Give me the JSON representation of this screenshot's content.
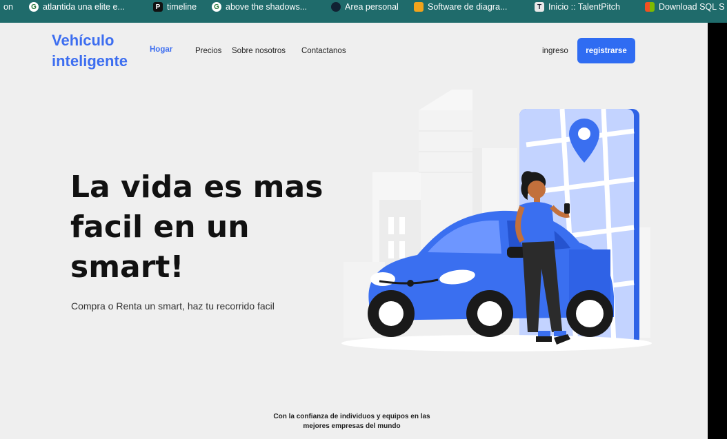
{
  "bookmarks": [
    {
      "label": "on",
      "icon": "none"
    },
    {
      "label": "atlantida una elite e...",
      "icon": "google-icon"
    },
    {
      "label": "timeline",
      "icon": "p-icon"
    },
    {
      "label": "above the shadows...",
      "icon": "google-icon"
    },
    {
      "label": "Area personal",
      "icon": "avatar-icon"
    },
    {
      "label": "Software de diagra...",
      "icon": "diagram-app-icon"
    },
    {
      "label": "Inicio :: TalentPitch",
      "icon": "talentpitch-icon"
    },
    {
      "label": "Download SQL S",
      "icon": "microsoft-icon"
    }
  ],
  "nav": {
    "brand": "Vehículo inteligente",
    "links": [
      "Hogar",
      "Precios",
      "Sobre nosotros",
      "Contactanos"
    ],
    "login": "ingreso",
    "signup": "registrarse"
  },
  "hero": {
    "title": "La vida es mas facil en un smart!",
    "subtitle": "Compra o Renta un smart, haz tu recorrido facil"
  },
  "trust": {
    "line1": "Con la confianza de individuos y equipos en las",
    "line2": "mejores empresas del mundo"
  },
  "colors": {
    "accent": "#2f6cf2",
    "car": "#3a6ff0",
    "bookmark_bar": "#1f6b6b"
  }
}
